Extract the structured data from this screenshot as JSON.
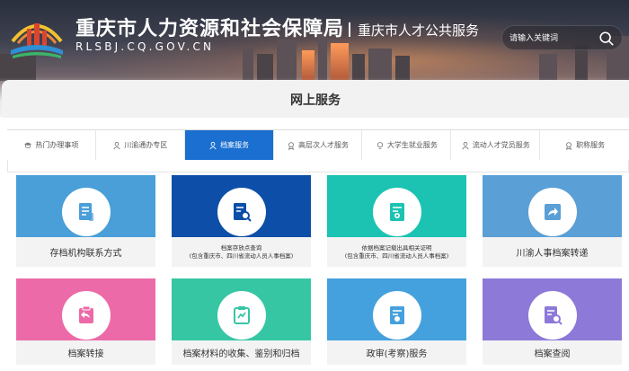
{
  "header": {
    "title_cn": "重庆市人力资源和社会保障局",
    "title_en": "RLSBJ.CQ.GOV.CN",
    "subtitle": "重庆市人才公共服务",
    "search_placeholder": "请输入关键词"
  },
  "section_title": "网上服务",
  "tabs": [
    {
      "label": "热门办理事项",
      "icon": "graduation-cap-icon",
      "active": false
    },
    {
      "label": "川渝通办专区",
      "icon": "person-icon",
      "active": false
    },
    {
      "label": "档案服务",
      "icon": "person-icon",
      "active": true
    },
    {
      "label": "高层次人才服务",
      "icon": "award-icon",
      "active": false
    },
    {
      "label": "大学生就业服务",
      "icon": "bulb-icon",
      "active": false
    },
    {
      "label": "流动人才党员服务",
      "icon": "person-icon",
      "active": false
    },
    {
      "label": "职称服务",
      "icon": "award-icon",
      "active": false
    }
  ],
  "cards": [
    {
      "label": "存档机构联系方式",
      "note": "",
      "icon": "document-icon",
      "color": "#4a9fd8"
    },
    {
      "label": "档案存放点查询",
      "note": "(包含重庆市、四川省流动人员人事档案)",
      "icon": "search-document-icon",
      "color": "#0d4fa8"
    },
    {
      "label": "依据档案记载出具相关证明",
      "note": "(包含重庆市、四川省流动人员人事档案)",
      "icon": "certificate-icon",
      "color": "#1cc3b2"
    },
    {
      "label": "川渝人事档案转递",
      "note": "",
      "icon": "forward-icon",
      "color": "#5a9fd6"
    },
    {
      "label": "档案转接",
      "note": "",
      "icon": "transfer-icon",
      "color": "#ec6aa7"
    },
    {
      "label": "档案材料的收集、鉴别和归档",
      "note": "",
      "icon": "clipboard-icon",
      "color": "#37c6a4"
    },
    {
      "label": "政审(考察)服务",
      "note": "",
      "icon": "badge-document-icon",
      "color": "#45a1dd"
    },
    {
      "label": "档案查阅",
      "note": "",
      "icon": "search-document-icon",
      "color": "#8d79d8"
    }
  ]
}
